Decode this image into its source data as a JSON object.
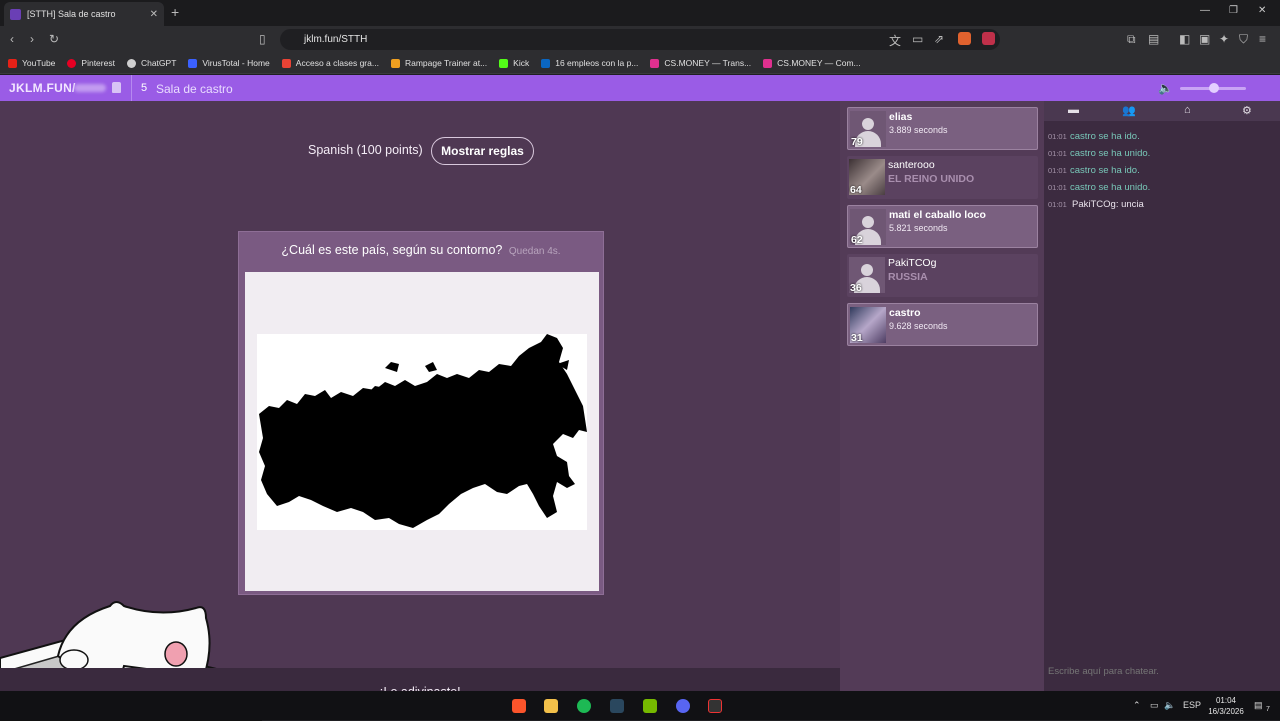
{
  "browser": {
    "tab_title": "[STTH] Sala de castro",
    "url": "jklm.fun/STTH",
    "bookmarks": [
      "YouTube",
      "Pinterest",
      "ChatGPT",
      "VirusTotal - Home",
      "Acceso a clases gra...",
      "Rampage Trainer at...",
      "Kick",
      "16 empleos con la p...",
      "CS.MONEY — Trans...",
      "CS.MONEY — Com..."
    ]
  },
  "header": {
    "brand": "JKLM.FUN/",
    "room_count": "5",
    "room_name": "Sala de castro"
  },
  "game": {
    "language": "Spanish (100 points)",
    "rules_button": "Mostrar reglas",
    "question": "¿Cuál es este país, según su contorno?",
    "time_left": "Quedan 4s.",
    "result": "¡Lo adivinaste!"
  },
  "scoreboard": [
    {
      "points": "79",
      "name": "elias",
      "info": "3.889 seconds",
      "answered": true
    },
    {
      "points": "64",
      "name": "santerooo",
      "info": "EL REINO UNIDO",
      "answered": false
    },
    {
      "points": "62",
      "name": "mati el caballo loco",
      "info": "5.821 seconds",
      "answered": true
    },
    {
      "points": "36",
      "name": "PakiTCOg",
      "info": "RUSSIA",
      "answered": false
    },
    {
      "points": "31",
      "name": "castro",
      "info": "9.628 seconds",
      "answered": true
    }
  ],
  "chat": {
    "messages": [
      {
        "time": "01:01",
        "text": "castro se ha ido."
      },
      {
        "time": "01:01",
        "text": "castro se ha unido."
      },
      {
        "time": "01:01",
        "text": "castro se ha ido."
      },
      {
        "time": "01:01",
        "text": "castro se ha unido."
      },
      {
        "time": "01:01",
        "text": "PakiTCOg: uncia"
      }
    ],
    "input_placeholder": "Escribe aquí para chatear."
  },
  "taskbar": {
    "lang": "ESP",
    "time": "01:04",
    "date": "16/3/2026",
    "notif_count": "7"
  }
}
